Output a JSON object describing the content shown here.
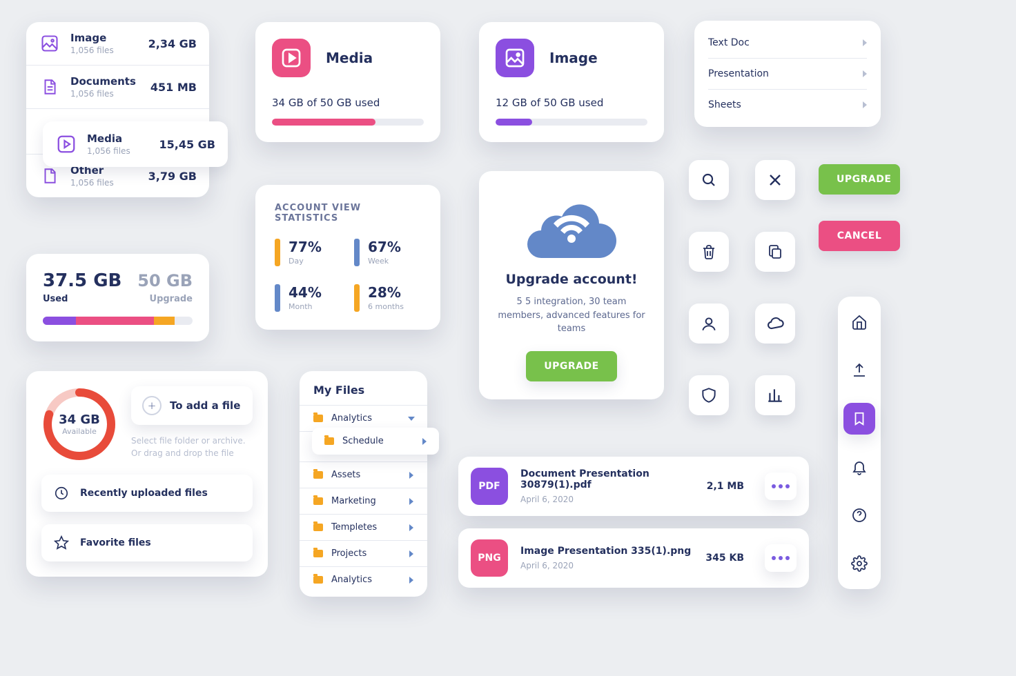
{
  "categories": [
    {
      "name": "Image",
      "sub": "1,056 files",
      "size": "2,34 GB"
    },
    {
      "name": "Documents",
      "sub": "1,056 files",
      "size": "451 MB"
    },
    {
      "name": "Media",
      "sub": "1,056 files",
      "size": "15,45 GB"
    },
    {
      "name": "Other",
      "sub": "1,056 files",
      "size": "3,79 GB"
    }
  ],
  "mediaCard": {
    "title": "Media",
    "text": "34 GB of 50 GB used",
    "pct": 68
  },
  "imageCard": {
    "title": "Image",
    "text": "12 GB of 50 GB used",
    "pct": 24
  },
  "ctx": [
    "Text Doc",
    "Presentation",
    "Sheets"
  ],
  "used": {
    "val": "37.5 GB",
    "max": "50 GB",
    "l1": "Used",
    "l2": "Upgrade",
    "seg": [
      22,
      52,
      14
    ]
  },
  "stats": {
    "title": "ACCOUNT VIEW STATISTICS",
    "items": [
      {
        "v": "77%",
        "l": "Day",
        "c": "#f5a623"
      },
      {
        "v": "67%",
        "l": "Week",
        "c": "#6388c8"
      },
      {
        "v": "44%",
        "l": "Month",
        "c": "#6388c8"
      },
      {
        "v": "28%",
        "l": "6 months",
        "c": "#f5a623"
      }
    ]
  },
  "upgrade": {
    "title": "Upgrade account!",
    "desc": "5 5 integration, 30 team members, advanced features for teams",
    "btn": "UPGRADE"
  },
  "btns": {
    "upgrade": "UPGRADE",
    "cancel": "CANCEL"
  },
  "upload": {
    "val": "34 GB",
    "sub": "Available",
    "add": "To add a file",
    "hint1": "Select file folder or archive.",
    "hint2": "Or drag and drop the file",
    "recent": "Recently uploaded files",
    "fav": "Favorite files"
  },
  "myfiles": {
    "title": "My Files",
    "items": [
      "Analytics",
      "Assets",
      "Marketing",
      "Templetes",
      "Projects",
      "Analytics"
    ],
    "popup": "Schedule"
  },
  "fileList": [
    {
      "badge": "PDF",
      "color": "#8b4fe0",
      "name": "Document Presentation 30879(1).pdf",
      "size": "2,1 MB",
      "date": "April 6, 2020"
    },
    {
      "badge": "PNG",
      "color": "#eb4f83",
      "name": "Image Presentation 335(1).png",
      "size": "345 KB",
      "date": "April 6, 2020"
    }
  ]
}
